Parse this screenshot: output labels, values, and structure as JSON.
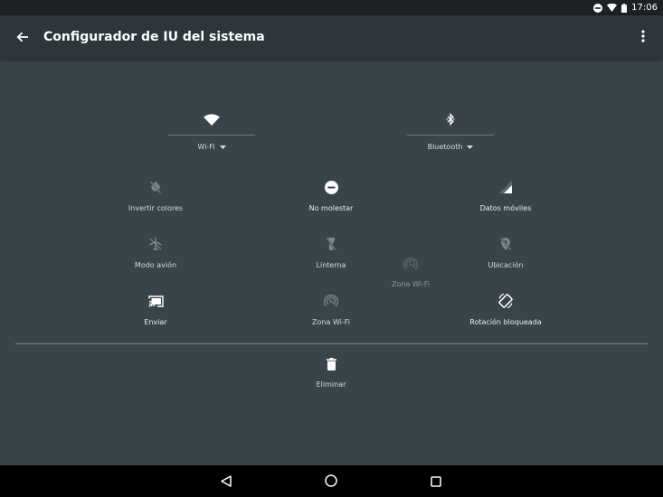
{
  "status_bar": {
    "time": "17:06"
  },
  "toolbar": {
    "title": "Configurador de IU del sistema"
  },
  "big_tiles": [
    {
      "label": "Wi-Fi",
      "icon": "wifi-icon"
    },
    {
      "label": "Bluetooth",
      "icon": "bluetooth-icon"
    }
  ],
  "tiles": [
    {
      "label": "Invertir colores",
      "icon": "invert-colors-off-icon"
    },
    {
      "label": "No molestar",
      "icon": "do-not-disturb-icon"
    },
    {
      "label": "Datos móviles",
      "icon": "cellular-signal-icon"
    },
    {
      "label": "Modo avión",
      "icon": "airplane-mode-off-icon"
    },
    {
      "label": "Linterna",
      "icon": "flashlight-off-icon"
    },
    {
      "label": "Ubicación",
      "icon": "location-off-icon"
    },
    {
      "label": "Enviar",
      "icon": "cast-icon"
    },
    {
      "label": "Zona Wi-Fi",
      "icon": "hotspot-icon"
    },
    {
      "label": "Rotación bloqueada",
      "icon": "screen-rotation-icon"
    }
  ],
  "dragging_tile": {
    "label": "Zona Wi-Fi",
    "icon": "hotspot-icon"
  },
  "remove_area": {
    "label": "Eliminar",
    "icon": "delete-icon"
  },
  "colors": {
    "background": "#39434a",
    "toolbar": "#2d363b",
    "status_bar": "#1b2124",
    "nav_bar": "#000000"
  }
}
